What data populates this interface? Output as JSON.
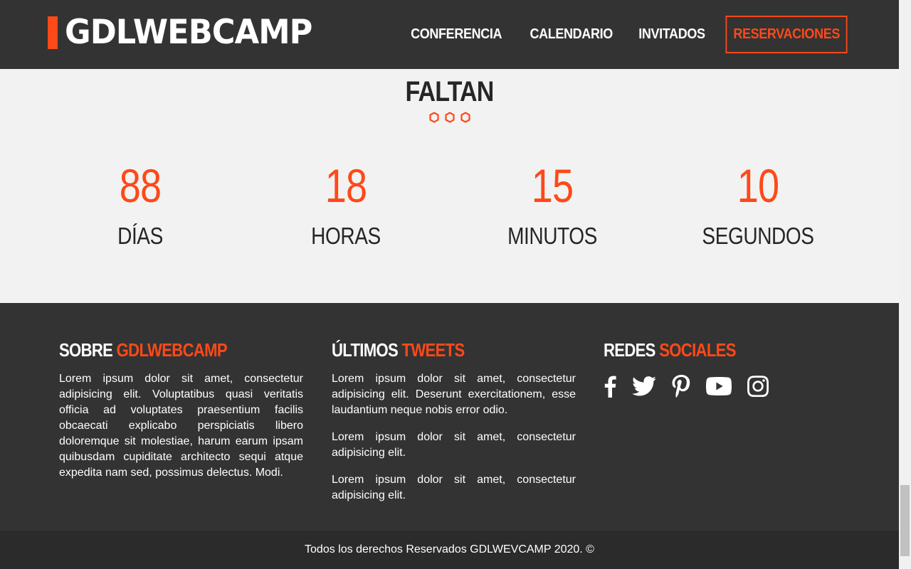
{
  "header": {
    "logo": "GDLWEBCAMP",
    "nav": [
      "CONFERENCIA",
      "CALENDARIO",
      "INVITADOS"
    ],
    "cta": "RESERVACIONES",
    "accent_color": "#fe4918"
  },
  "countdown": {
    "title": "FALTAN",
    "items": [
      {
        "value": "88",
        "label": "DÍAS"
      },
      {
        "value": "18",
        "label": "HORAS"
      },
      {
        "value": "15",
        "label": "MINUTOS"
      },
      {
        "value": "10",
        "label": "SEGUNDOS"
      }
    ]
  },
  "footer": {
    "about": {
      "title_white": "SOBRE",
      "title_accent": "GDLWEBCAMP",
      "text": "Lorem ipsum dolor sit amet, consectetur adipisicing elit. Voluptatibus quasi veritatis officia ad voluptates praesentium facilis obcaecati explicabo perspiciatis libero doloremque sit molestiae, harum earum ipsam quibusdam cupiditate architecto sequi atque expedita nam sed, possimus delectus. Modi."
    },
    "tweets": {
      "title_white": "ÚLTIMOS",
      "title_accent": "TWEETS",
      "items": [
        "Lorem ipsum dolor sit amet, consectetur adipisicing elit. Deserunt exercitationem, esse laudantium neque nobis error odio.",
        "Lorem ipsum dolor sit amet, consectetur adipisicing elit.",
        "Lorem ipsum dolor sit amet, consectetur adipisicing elit."
      ]
    },
    "social": {
      "title_white": "REDES",
      "title_accent": "SOCIALES",
      "icons": [
        "facebook-icon",
        "twitter-icon",
        "pinterest-icon",
        "youtube-icon",
        "instagram-icon"
      ]
    },
    "copyright": "Todos los derechos Reservados GDLWEVCAMP 2020. ©"
  }
}
